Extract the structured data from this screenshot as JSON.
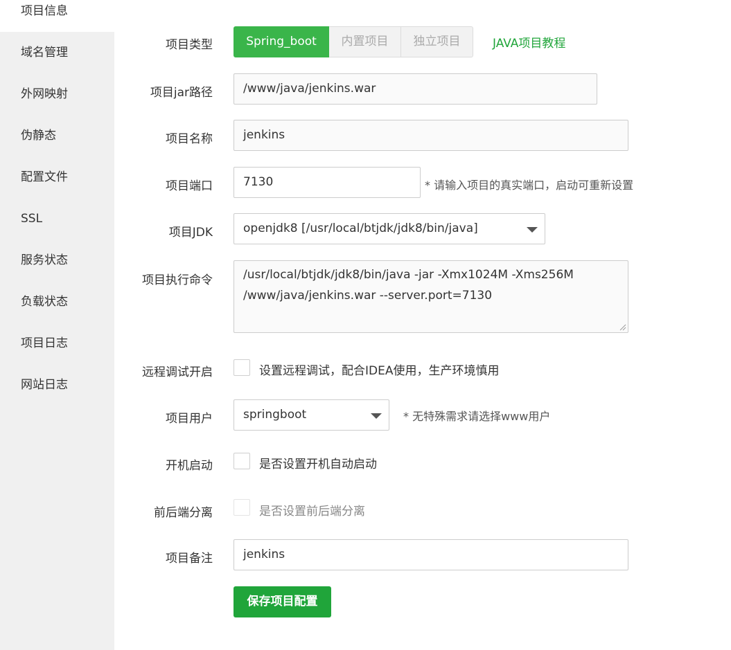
{
  "sidebar": {
    "items": [
      {
        "label": "项目信息"
      },
      {
        "label": "域名管理"
      },
      {
        "label": "外网映射"
      },
      {
        "label": "伪静态"
      },
      {
        "label": "配置文件"
      },
      {
        "label": "SSL"
      },
      {
        "label": "服务状态"
      },
      {
        "label": "负载状态"
      },
      {
        "label": "项目日志"
      },
      {
        "label": "网站日志"
      }
    ]
  },
  "form": {
    "project_type": {
      "label": "项目类型",
      "options": [
        "Spring_boot",
        "内置项目",
        "独立项目"
      ],
      "selected": "Spring_boot",
      "tutorial_link": "JAVA项目教程"
    },
    "jar_path": {
      "label": "项目jar路径",
      "value": "/www/java/jenkins.war"
    },
    "project_name": {
      "label": "项目名称",
      "value": "jenkins"
    },
    "project_port": {
      "label": "项目端口",
      "value": "7130",
      "hint": "* 请输入项目的真实端口，启动可重新设置"
    },
    "project_jdk": {
      "label": "项目JDK",
      "value": "openjdk8 [/usr/local/btjdk/jdk8/bin/java]"
    },
    "exec_command": {
      "label": "项目执行命令",
      "line1": "/usr/local/btjdk/jdk8/bin/java -jar -Xmx1024M -Xms256M",
      "line2": "/www/java/jenkins.war --server.port=7130"
    },
    "remote_debug": {
      "label": "远程调试开启",
      "text": "设置远程调试，配合IDEA使用，生产环境慎用",
      "checked": false
    },
    "project_user": {
      "label": "项目用户",
      "value": "springboot",
      "hint": "* 无特殊需求请选择www用户"
    },
    "auto_start": {
      "label": "开机启动",
      "text": "是否设置开机自动启动",
      "checked": false
    },
    "separation": {
      "label": "前后端分离",
      "text": "是否设置前后端分离",
      "checked": false
    },
    "remark": {
      "label": "项目备注",
      "value": "jenkins"
    },
    "save_label": "保存项目配置"
  },
  "colors": {
    "accent": "#20a53a",
    "segment_active": "#3ab54a",
    "sidebar_bg": "#f0f0f0"
  }
}
